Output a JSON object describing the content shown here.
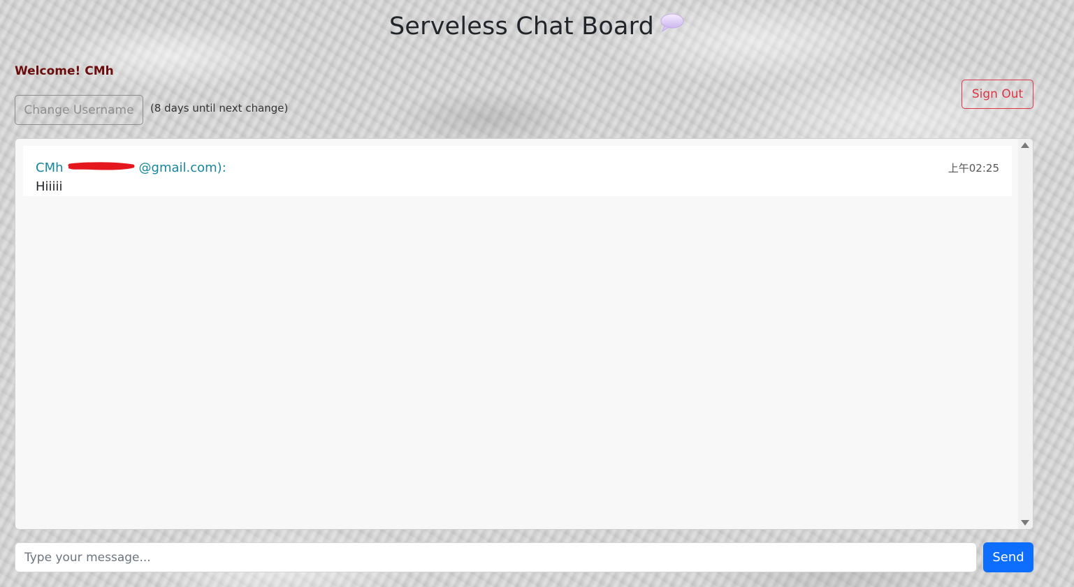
{
  "header": {
    "title": "Serveless Chat Board",
    "title_icon": "speech-bubble-icon"
  },
  "user": {
    "welcome_label": "Welcome!",
    "username": "CMh"
  },
  "controls": {
    "change_username_label": "Change Username",
    "change_username_note": "(8 days until next change)",
    "sign_out_label": "Sign Out"
  },
  "messages": [
    {
      "sender": "CMh",
      "email_visible_suffix": "@gmail.com):",
      "email_redacted": true,
      "time": "上午02:25",
      "text": "Hiiiii"
    }
  ],
  "composer": {
    "placeholder": "Type your message...",
    "send_label": "Send"
  },
  "colors": {
    "welcome": "#6b0d0d",
    "sender": "#17869e",
    "sign_out": "#dc3545",
    "send_button": "#0d6efd",
    "redaction": "#e3171d"
  }
}
